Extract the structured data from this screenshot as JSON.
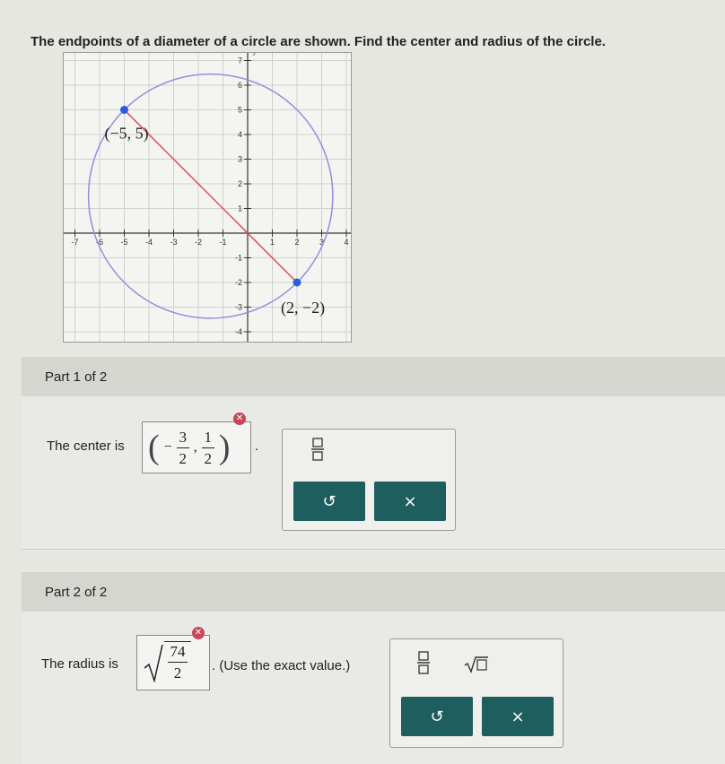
{
  "question": "The endpoints of a diameter of a circle are shown. Find the center and radius of the circle.",
  "graph": {
    "x_axis_label": "x",
    "y_axis_label": "y",
    "x_ticks": [
      "-7",
      "-6",
      "-5",
      "-4",
      "-3",
      "-2",
      "-1",
      "1",
      "2",
      "3",
      "4"
    ],
    "y_ticks": [
      "7",
      "6",
      "5",
      "4",
      "3",
      "2",
      "1",
      "-1",
      "-2",
      "-3",
      "-4"
    ],
    "point_a": {
      "label": "(−5, 5)",
      "x": -5,
      "y": 5
    },
    "point_b": {
      "label": "(2, −2)",
      "x": 2,
      "y": -2
    },
    "colors": {
      "circle": "#8f8fe0",
      "segment": "#e24a5e",
      "point": "#2f5be0",
      "grid": "#d0d0d0"
    }
  },
  "part1": {
    "header": "Part 1 of 2",
    "prompt": "The center is",
    "answer": {
      "open": "(",
      "x_sign": "−",
      "x_num": "3",
      "x_den": "2",
      "sep": ",",
      "y_num": "1",
      "y_den": "2",
      "close": ")"
    },
    "trailing": ".",
    "error_icon": "x-mark",
    "tools": {
      "fraction_icon": "fraction-template",
      "undo_icon": "↺",
      "clear_icon": "×"
    }
  },
  "part2": {
    "header": "Part 2 of 2",
    "prompt": "The radius is",
    "answer": {
      "radical": "√",
      "num": "74",
      "den": "2"
    },
    "trailing": ". (Use the exact value.)",
    "error_icon": "x-mark",
    "tools": {
      "fraction_icon": "fraction-template",
      "sqrt_icon": "sqrt-template",
      "undo_icon": "↺",
      "clear_icon": "×"
    }
  },
  "colors": {
    "accent_button": "#1f5e5e",
    "error": "#c9465c"
  }
}
